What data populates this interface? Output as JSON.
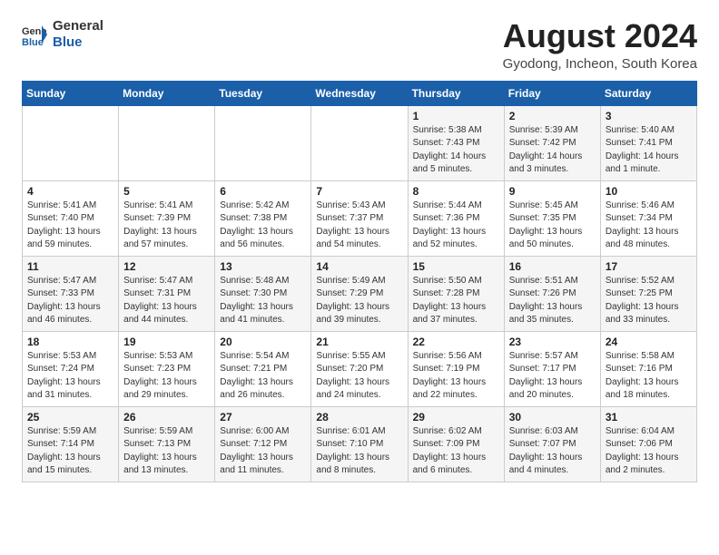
{
  "header": {
    "logo_general": "General",
    "logo_blue": "Blue",
    "title": "August 2024",
    "subtitle": "Gyodong, Incheon, South Korea"
  },
  "weekdays": [
    "Sunday",
    "Monday",
    "Tuesday",
    "Wednesday",
    "Thursday",
    "Friday",
    "Saturday"
  ],
  "weeks": [
    [
      {
        "day": "",
        "info": ""
      },
      {
        "day": "",
        "info": ""
      },
      {
        "day": "",
        "info": ""
      },
      {
        "day": "",
        "info": ""
      },
      {
        "day": "1",
        "info": "Sunrise: 5:38 AM\nSunset: 7:43 PM\nDaylight: 14 hours\nand 5 minutes."
      },
      {
        "day": "2",
        "info": "Sunrise: 5:39 AM\nSunset: 7:42 PM\nDaylight: 14 hours\nand 3 minutes."
      },
      {
        "day": "3",
        "info": "Sunrise: 5:40 AM\nSunset: 7:41 PM\nDaylight: 14 hours\nand 1 minute."
      }
    ],
    [
      {
        "day": "4",
        "info": "Sunrise: 5:41 AM\nSunset: 7:40 PM\nDaylight: 13 hours\nand 59 minutes."
      },
      {
        "day": "5",
        "info": "Sunrise: 5:41 AM\nSunset: 7:39 PM\nDaylight: 13 hours\nand 57 minutes."
      },
      {
        "day": "6",
        "info": "Sunrise: 5:42 AM\nSunset: 7:38 PM\nDaylight: 13 hours\nand 56 minutes."
      },
      {
        "day": "7",
        "info": "Sunrise: 5:43 AM\nSunset: 7:37 PM\nDaylight: 13 hours\nand 54 minutes."
      },
      {
        "day": "8",
        "info": "Sunrise: 5:44 AM\nSunset: 7:36 PM\nDaylight: 13 hours\nand 52 minutes."
      },
      {
        "day": "9",
        "info": "Sunrise: 5:45 AM\nSunset: 7:35 PM\nDaylight: 13 hours\nand 50 minutes."
      },
      {
        "day": "10",
        "info": "Sunrise: 5:46 AM\nSunset: 7:34 PM\nDaylight: 13 hours\nand 48 minutes."
      }
    ],
    [
      {
        "day": "11",
        "info": "Sunrise: 5:47 AM\nSunset: 7:33 PM\nDaylight: 13 hours\nand 46 minutes."
      },
      {
        "day": "12",
        "info": "Sunrise: 5:47 AM\nSunset: 7:31 PM\nDaylight: 13 hours\nand 44 minutes."
      },
      {
        "day": "13",
        "info": "Sunrise: 5:48 AM\nSunset: 7:30 PM\nDaylight: 13 hours\nand 41 minutes."
      },
      {
        "day": "14",
        "info": "Sunrise: 5:49 AM\nSunset: 7:29 PM\nDaylight: 13 hours\nand 39 minutes."
      },
      {
        "day": "15",
        "info": "Sunrise: 5:50 AM\nSunset: 7:28 PM\nDaylight: 13 hours\nand 37 minutes."
      },
      {
        "day": "16",
        "info": "Sunrise: 5:51 AM\nSunset: 7:26 PM\nDaylight: 13 hours\nand 35 minutes."
      },
      {
        "day": "17",
        "info": "Sunrise: 5:52 AM\nSunset: 7:25 PM\nDaylight: 13 hours\nand 33 minutes."
      }
    ],
    [
      {
        "day": "18",
        "info": "Sunrise: 5:53 AM\nSunset: 7:24 PM\nDaylight: 13 hours\nand 31 minutes."
      },
      {
        "day": "19",
        "info": "Sunrise: 5:53 AM\nSunset: 7:23 PM\nDaylight: 13 hours\nand 29 minutes."
      },
      {
        "day": "20",
        "info": "Sunrise: 5:54 AM\nSunset: 7:21 PM\nDaylight: 13 hours\nand 26 minutes."
      },
      {
        "day": "21",
        "info": "Sunrise: 5:55 AM\nSunset: 7:20 PM\nDaylight: 13 hours\nand 24 minutes."
      },
      {
        "day": "22",
        "info": "Sunrise: 5:56 AM\nSunset: 7:19 PM\nDaylight: 13 hours\nand 22 minutes."
      },
      {
        "day": "23",
        "info": "Sunrise: 5:57 AM\nSunset: 7:17 PM\nDaylight: 13 hours\nand 20 minutes."
      },
      {
        "day": "24",
        "info": "Sunrise: 5:58 AM\nSunset: 7:16 PM\nDaylight: 13 hours\nand 18 minutes."
      }
    ],
    [
      {
        "day": "25",
        "info": "Sunrise: 5:59 AM\nSunset: 7:14 PM\nDaylight: 13 hours\nand 15 minutes."
      },
      {
        "day": "26",
        "info": "Sunrise: 5:59 AM\nSunset: 7:13 PM\nDaylight: 13 hours\nand 13 minutes."
      },
      {
        "day": "27",
        "info": "Sunrise: 6:00 AM\nSunset: 7:12 PM\nDaylight: 13 hours\nand 11 minutes."
      },
      {
        "day": "28",
        "info": "Sunrise: 6:01 AM\nSunset: 7:10 PM\nDaylight: 13 hours\nand 8 minutes."
      },
      {
        "day": "29",
        "info": "Sunrise: 6:02 AM\nSunset: 7:09 PM\nDaylight: 13 hours\nand 6 minutes."
      },
      {
        "day": "30",
        "info": "Sunrise: 6:03 AM\nSunset: 7:07 PM\nDaylight: 13 hours\nand 4 minutes."
      },
      {
        "day": "31",
        "info": "Sunrise: 6:04 AM\nSunset: 7:06 PM\nDaylight: 13 hours\nand 2 minutes."
      }
    ]
  ]
}
